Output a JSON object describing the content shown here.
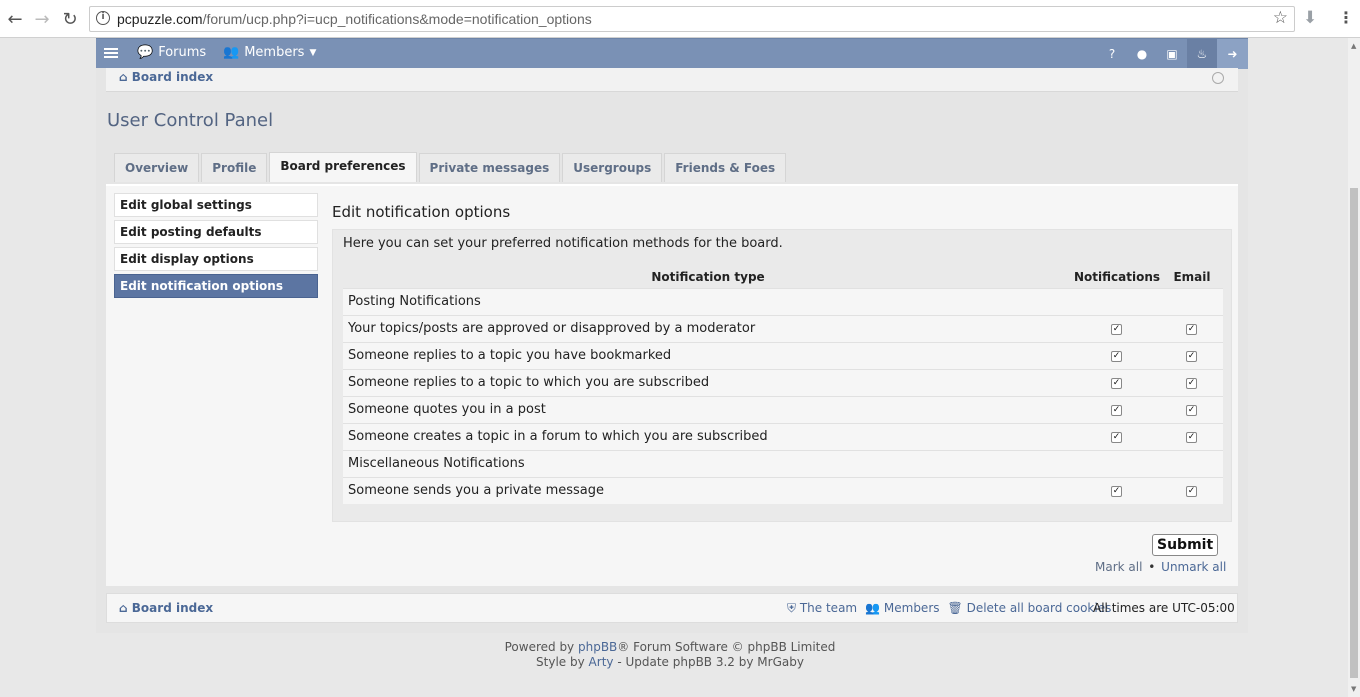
{
  "browser": {
    "url_host": "pcpuzzle.com",
    "url_rest": "/forum/ucp.php?i=ucp_notifications&mode=notification_options"
  },
  "topbar": {
    "forums": "Forums",
    "members": "Members"
  },
  "breadcrumb": {
    "board_index": "Board index"
  },
  "page_title": "User Control Panel",
  "tabs": [
    {
      "label": "Overview"
    },
    {
      "label": "Profile"
    },
    {
      "label": "Board preferences"
    },
    {
      "label": "Private messages"
    },
    {
      "label": "Usergroups"
    },
    {
      "label": "Friends & Foes"
    }
  ],
  "side": [
    {
      "label": "Edit global settings"
    },
    {
      "label": "Edit posting defaults"
    },
    {
      "label": "Edit display options"
    },
    {
      "label": "Edit notification options"
    }
  ],
  "content": {
    "heading": "Edit notification options",
    "intro": "Here you can set your preferred notification methods for the board.",
    "col_type": "Notification type",
    "col_notifications": "Notifications",
    "col_email": "Email",
    "rows": [
      {
        "label": "Posting Notifications"
      },
      {
        "label": "Your topics/posts are approved or disapproved by a moderator",
        "notif": true,
        "email": true
      },
      {
        "label": "Someone replies to a topic you have bookmarked",
        "notif": true,
        "email": true
      },
      {
        "label": "Someone replies to a topic to which you are subscribed",
        "notif": true,
        "email": true
      },
      {
        "label": "Someone quotes you in a post",
        "notif": true,
        "email": true
      },
      {
        "label": "Someone creates a topic in a forum to which you are subscribed",
        "notif": true,
        "email": true
      },
      {
        "label": "Miscellaneous Notifications"
      },
      {
        "label": "Someone sends you a private message",
        "notif": true,
        "email": true
      }
    ],
    "submit": "Submit",
    "mark_all": "Mark all",
    "unmark_all": "Unmark all"
  },
  "footer": {
    "board_index": "Board index",
    "team": "The team",
    "members": "Members",
    "delete_cookies": "Delete all board cookies",
    "timezone": "All times are UTC-05:00"
  },
  "powered": {
    "prefix": "Powered by ",
    "phpbb": "phpBB",
    "suffix": "® Forum Software © phpBB Limited",
    "style_prefix": "Style by ",
    "arty": "Arty",
    "style_suffix": " - Update phpBB 3.2 by MrGaby"
  }
}
